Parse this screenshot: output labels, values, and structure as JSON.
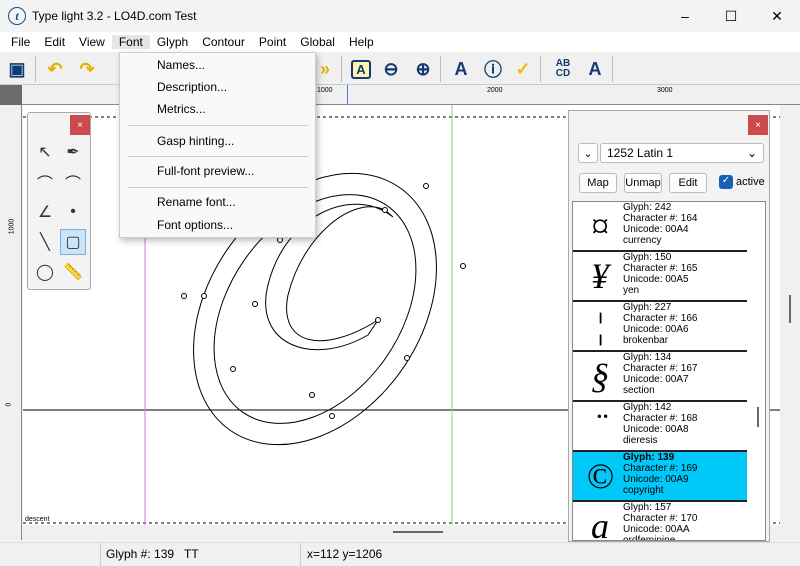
{
  "window": {
    "title": "Type light 3.2  -  LO4D.com Test",
    "minimize": "–",
    "maximize": "☐",
    "close": "✕"
  },
  "menu": [
    "File",
    "Edit",
    "View",
    "Font",
    "Glyph",
    "Contour",
    "Point",
    "Global",
    "Help"
  ],
  "font_menu": {
    "items": [
      "Names...",
      "Description...",
      "Metrics...",
      "Gasp hinting...",
      "Full-font preview...",
      "Rename font...",
      "Font options..."
    ]
  },
  "toolbar": {
    "icons": [
      "save-icon",
      "undo-icon",
      "redo-icon",
      "next-icon",
      "outline-box-icon",
      "zoom-out-icon",
      "zoom-in-icon",
      "advance-width-icon",
      "info-icon",
      "check-icon",
      "abcd-icon",
      "outline-a-icon"
    ]
  },
  "ruler": {
    "h_labels": [
      "1000",
      "2000",
      "3000"
    ],
    "v_labels": [
      "1000",
      "0"
    ]
  },
  "canvas": {
    "descent_label": "descent"
  },
  "glyph_panel": {
    "close": "×",
    "codepage": "1252 Latin 1",
    "map": "Map",
    "unmap": "Unmap",
    "edit": "Edit",
    "active_label": "active",
    "active": true,
    "items": [
      {
        "symbol": "¤",
        "glyph": "Glyph: 242",
        "char": "Character #: 164",
        "unicode": "Unicode: 00A4",
        "name": "currency"
      },
      {
        "symbol": "¥",
        "glyph": "Glyph: 150",
        "char": "Character #: 165",
        "unicode": "Unicode: 00A5",
        "name": "yen"
      },
      {
        "symbol": "¦",
        "glyph": "Glyph: 227",
        "char": "Character #: 166",
        "unicode": "Unicode: 00A6",
        "name": "brokenbar"
      },
      {
        "symbol": "§",
        "glyph": "Glyph: 134",
        "char": "Character #: 167",
        "unicode": "Unicode: 00A7",
        "name": "section"
      },
      {
        "symbol": "¨",
        "glyph": "Glyph: 142",
        "char": "Character #: 168",
        "unicode": "Unicode: 00A8",
        "name": "dieresis"
      },
      {
        "symbol": "©",
        "glyph": "Glyph: 139",
        "char": "Character #: 169",
        "unicode": "Unicode: 00A9",
        "name": "copyright",
        "selected": true
      },
      {
        "symbol": "a",
        "glyph": "Glyph: 157",
        "char": "Character #: 170",
        "unicode": "Unicode: 00AA",
        "name": "ordfeminine"
      }
    ]
  },
  "tools": {
    "close": "×"
  },
  "status": {
    "glyph": "Glyph #: 139",
    "format": "TT",
    "coords": "x=112  y=1206"
  },
  "colors": {
    "selection": "#00c8f8",
    "close_red": "#c94b4b",
    "toolbar_blue": "#123a73"
  }
}
